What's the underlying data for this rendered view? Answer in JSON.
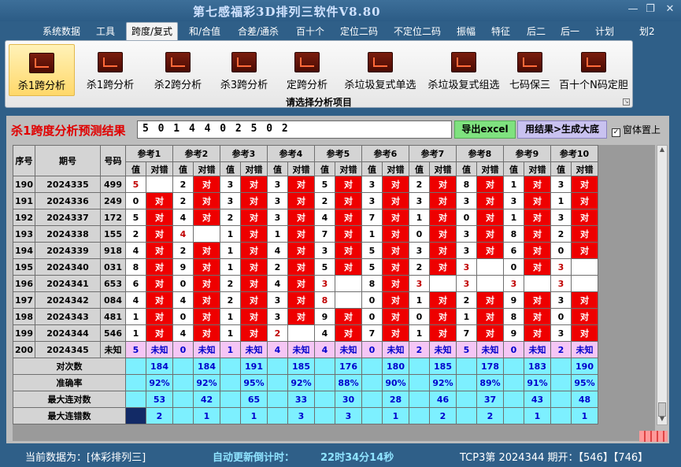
{
  "window": {
    "title": "第七感福彩3D排列三软件V8.80",
    "restore_glyph": "❐",
    "close_glyph": "✕"
  },
  "menu": [
    "系统数据",
    "工具",
    "跨度/复式",
    "和/合值",
    "合差/通杀",
    "百十个",
    "定位二码",
    "不定位二码",
    "振幅",
    "特征",
    "后二",
    "后一",
    "计划",
    "划2"
  ],
  "ribbon": {
    "buttons": [
      "杀1跨分析",
      "杀1跨分析",
      "杀2跨分析",
      "杀3跨分析",
      "定跨分析",
      "杀垃圾复式单选",
      "杀垃圾复式组选",
      "七码保三",
      "百十个N码定胆"
    ],
    "group_label": "请选择分析项目"
  },
  "panel": {
    "result_label": "杀1跨度分析预测结果",
    "result_value": "5 0 1 4 4 0 2 5 0 2",
    "export_button": "导出excel",
    "generate_button": "用结果>生成大底",
    "checkbox_label": "窗体置上",
    "checkbox_checked": true
  },
  "grid": {
    "headers": {
      "seq": "序号",
      "period": "期号",
      "number": "号码",
      "val": "值",
      "status": "对错"
    },
    "refs": [
      "参考1",
      "参考2",
      "参考3",
      "参考4",
      "参考5",
      "参考6",
      "参考7",
      "参考8",
      "参考9",
      "参考10"
    ],
    "dui": "对",
    "rows": [
      {
        "seq": "190",
        "period": "2024335",
        "number": "499",
        "cells": [
          [
            "5",
            "N"
          ],
          [
            "2",
            "D"
          ],
          [
            "3",
            "D"
          ],
          [
            "3",
            "D"
          ],
          [
            "5",
            "D"
          ],
          [
            "3",
            "D"
          ],
          [
            "2",
            "D"
          ],
          [
            "8",
            "D"
          ],
          [
            "1",
            "D"
          ],
          [
            "3",
            "D"
          ]
        ]
      },
      {
        "seq": "191",
        "period": "2024336",
        "number": "249",
        "cells": [
          [
            "0",
            "D"
          ],
          [
            "2",
            "D"
          ],
          [
            "3",
            "D"
          ],
          [
            "3",
            "D"
          ],
          [
            "2",
            "D"
          ],
          [
            "3",
            "D"
          ],
          [
            "3",
            "D"
          ],
          [
            "3",
            "D"
          ],
          [
            "3",
            "D"
          ],
          [
            "1",
            "D"
          ]
        ]
      },
      {
        "seq": "192",
        "period": "2024337",
        "number": "172",
        "cells": [
          [
            "5",
            "D"
          ],
          [
            "4",
            "D"
          ],
          [
            "2",
            "D"
          ],
          [
            "3",
            "D"
          ],
          [
            "4",
            "D"
          ],
          [
            "7",
            "D"
          ],
          [
            "1",
            "D"
          ],
          [
            "0",
            "D"
          ],
          [
            "1",
            "D"
          ],
          [
            "3",
            "D"
          ]
        ]
      },
      {
        "seq": "193",
        "period": "2024338",
        "number": "155",
        "cells": [
          [
            "2",
            "D"
          ],
          [
            "4",
            "N"
          ],
          [
            "1",
            "D"
          ],
          [
            "1",
            "D"
          ],
          [
            "7",
            "D"
          ],
          [
            "1",
            "D"
          ],
          [
            "0",
            "D"
          ],
          [
            "3",
            "D"
          ],
          [
            "8",
            "D"
          ],
          [
            "2",
            "D"
          ]
        ]
      },
      {
        "seq": "194",
        "period": "2024339",
        "number": "918",
        "cells": [
          [
            "4",
            "D"
          ],
          [
            "2",
            "D"
          ],
          [
            "1",
            "D"
          ],
          [
            "4",
            "D"
          ],
          [
            "3",
            "D"
          ],
          [
            "5",
            "D"
          ],
          [
            "3",
            "D"
          ],
          [
            "3",
            "D"
          ],
          [
            "6",
            "D"
          ],
          [
            "0",
            "D"
          ]
        ]
      },
      {
        "seq": "195",
        "period": "2024340",
        "number": "031",
        "cells": [
          [
            "8",
            "D"
          ],
          [
            "9",
            "D"
          ],
          [
            "1",
            "D"
          ],
          [
            "2",
            "D"
          ],
          [
            "5",
            "D"
          ],
          [
            "5",
            "D"
          ],
          [
            "2",
            "D"
          ],
          [
            "3",
            "N"
          ],
          [
            "0",
            "D"
          ],
          [
            "3",
            "N"
          ]
        ]
      },
      {
        "seq": "196",
        "period": "2024341",
        "number": "653",
        "cells": [
          [
            "6",
            "D"
          ],
          [
            "0",
            "D"
          ],
          [
            "2",
            "D"
          ],
          [
            "4",
            "D"
          ],
          [
            "3",
            "N"
          ],
          [
            "8",
            "D"
          ],
          [
            "3",
            "N"
          ],
          [
            "3",
            "N"
          ],
          [
            "3",
            "N"
          ],
          [
            "3",
            "N"
          ]
        ]
      },
      {
        "seq": "197",
        "period": "2024342",
        "number": "084",
        "cells": [
          [
            "4",
            "D"
          ],
          [
            "4",
            "D"
          ],
          [
            "2",
            "D"
          ],
          [
            "3",
            "D"
          ],
          [
            "8",
            "N"
          ],
          [
            "0",
            "D"
          ],
          [
            "1",
            "D"
          ],
          [
            "2",
            "D"
          ],
          [
            "9",
            "D"
          ],
          [
            "3",
            "D"
          ]
        ]
      },
      {
        "seq": "198",
        "period": "2024343",
        "number": "481",
        "cells": [
          [
            "1",
            "D"
          ],
          [
            "0",
            "D"
          ],
          [
            "1",
            "D"
          ],
          [
            "3",
            "D"
          ],
          [
            "9",
            "D"
          ],
          [
            "0",
            "D"
          ],
          [
            "0",
            "D"
          ],
          [
            "1",
            "D"
          ],
          [
            "8",
            "D"
          ],
          [
            "0",
            "D"
          ]
        ]
      },
      {
        "seq": "199",
        "period": "2024344",
        "number": "546",
        "cells": [
          [
            "1",
            "D"
          ],
          [
            "4",
            "D"
          ],
          [
            "1",
            "D"
          ],
          [
            "2",
            "N"
          ],
          [
            "4",
            "D"
          ],
          [
            "7",
            "D"
          ],
          [
            "1",
            "D"
          ],
          [
            "7",
            "D"
          ],
          [
            "9",
            "D"
          ],
          [
            "3",
            "D"
          ]
        ]
      }
    ],
    "unknown_row": {
      "seq": "200",
      "period": "2024345",
      "number": "未知",
      "values": [
        "5",
        "0",
        "1",
        "4",
        "4",
        "0",
        "2",
        "5",
        "0",
        "2"
      ],
      "status": "未知"
    },
    "stats": [
      {
        "label": "对次数",
        "values": [
          "184",
          "184",
          "191",
          "185",
          "176",
          "180",
          "185",
          "178",
          "183",
          "190"
        ]
      },
      {
        "label": "准确率",
        "values": [
          "92%",
          "92%",
          "95%",
          "92%",
          "88%",
          "90%",
          "92%",
          "89%",
          "91%",
          "95%"
        ]
      },
      {
        "label": "最大连对数",
        "values": [
          "53",
          "42",
          "65",
          "33",
          "30",
          "28",
          "46",
          "37",
          "43",
          "48"
        ]
      },
      {
        "label": "最大连错数",
        "values": [
          "2",
          "1",
          "1",
          "3",
          "3",
          "1",
          "2",
          "2",
          "1",
          "1"
        ]
      }
    ]
  },
  "statusbar": {
    "current_data": "当前数据为：[体彩排列三]",
    "countdown_label": "自动更新倒计时：",
    "countdown_value": "22时34分14秒",
    "draw_info": "TCP3第 2024344 期开：【546】【746】"
  },
  "colors": {
    "red": "#ee0000",
    "cyan": "#7df0ff",
    "pink": "#f5c6f5",
    "blue_text": "#0000cc",
    "green_button": "#7fe27f",
    "purple_button": "#c9c2f0"
  },
  "icons": {
    "ribbon": "chart-icon",
    "checkbox": "checkbox-icon"
  }
}
